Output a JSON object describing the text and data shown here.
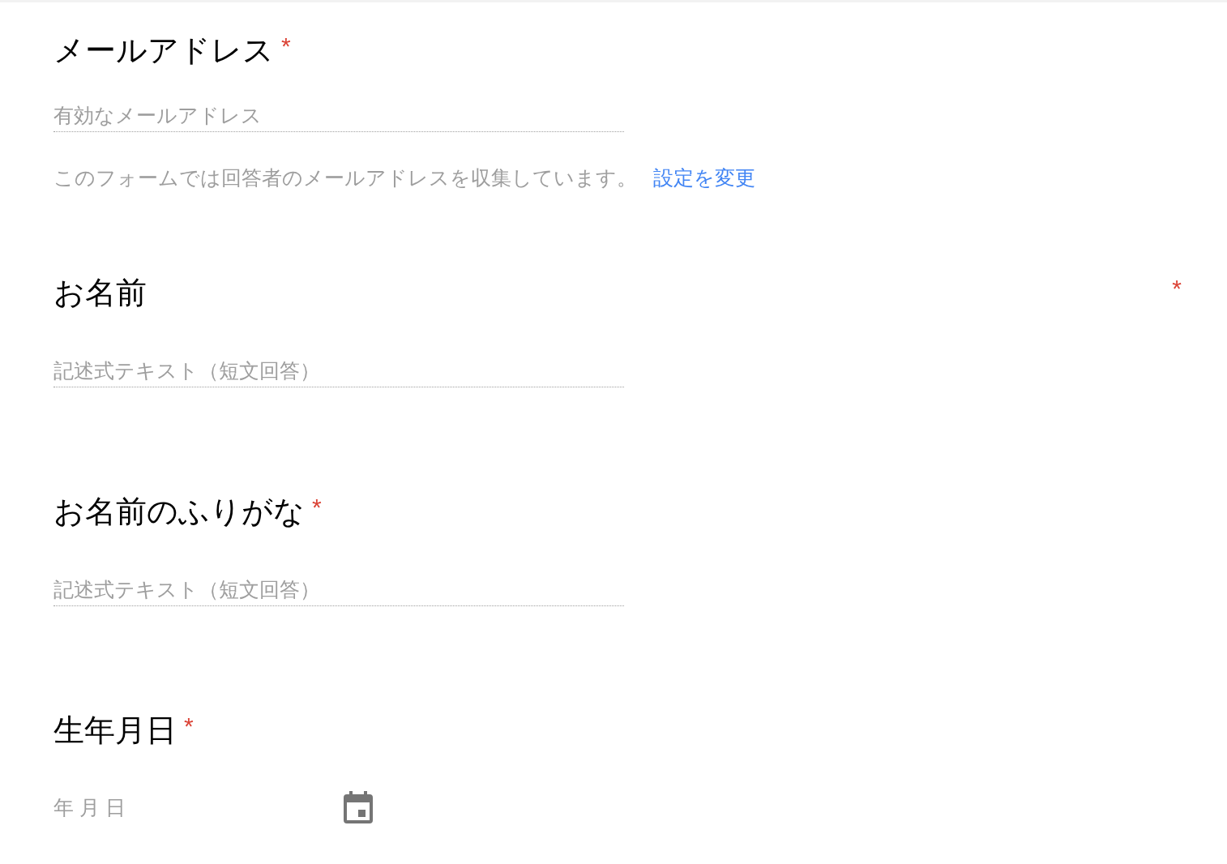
{
  "questions": [
    {
      "kind": "email",
      "title": "メールアドレス",
      "required": true,
      "required_mark": "*",
      "mark_at_far_right": false,
      "placeholder": "有効なメールアドレス",
      "note": "このフォームでは回答者のメールアドレスを収集しています。",
      "note_link": "設定を変更"
    },
    {
      "kind": "short_text",
      "title": "お名前",
      "required": true,
      "required_mark": "*",
      "mark_at_far_right": true,
      "placeholder": "記述式テキスト（短文回答）"
    },
    {
      "kind": "short_text",
      "title": "お名前のふりがな",
      "required": true,
      "required_mark": "*",
      "mark_at_far_right": false,
      "placeholder": "記述式テキスト（短文回答）"
    },
    {
      "kind": "date",
      "title": "生年月日",
      "required": true,
      "required_mark": "*",
      "mark_at_far_right": false,
      "placeholder": "年 月 日"
    }
  ]
}
